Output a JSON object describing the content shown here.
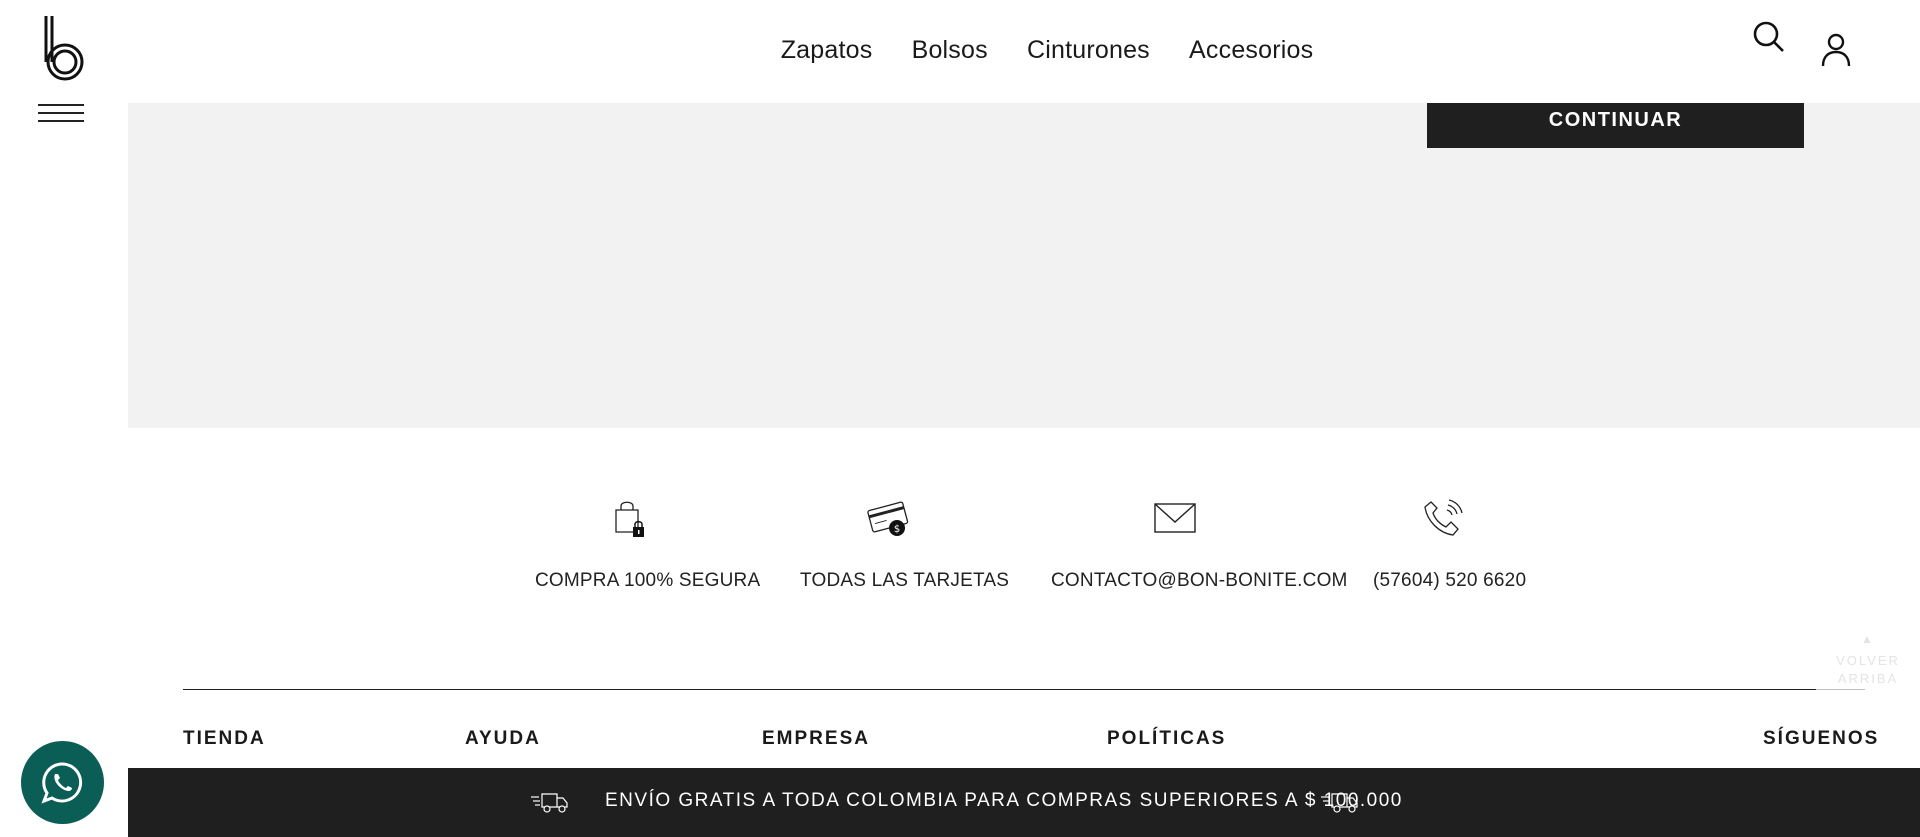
{
  "header": {
    "nav": [
      "Zapatos",
      "Bolsos",
      "Cinturones",
      "Accesorios"
    ],
    "icons": [
      "logo-b",
      "search-icon",
      "user-icon",
      "hamburger-menu-icon"
    ]
  },
  "main": {
    "continue_label": "CONTINUAR"
  },
  "features": [
    {
      "icon": "shopping-bag-lock-icon",
      "label": "COMPRA 100% SEGURA"
    },
    {
      "icon": "credit-card-icon",
      "label": "TODAS LAS TARJETAS"
    },
    {
      "icon": "envelope-icon",
      "label": "CONTACTO@BON-BONITE.COM"
    },
    {
      "icon": "phone-ringing-icon",
      "label": "(57604) 520 6620"
    }
  ],
  "footer": {
    "columns": [
      "TIENDA",
      "AYUDA",
      "EMPRESA",
      "POLÍTICAS",
      "SÍGUENOS"
    ],
    "back_to_top": "VOLVER ARRIBA"
  },
  "bottom_bar": {
    "text": "ENVÍO GRATIS A TODA COLOMBIA PARA COMPRAS SUPERIORES A $ 100.000",
    "icon": "delivery-truck-icon"
  },
  "colors": {
    "bar_dark": "#1f1f1f",
    "panel_gray": "#f2f2f2",
    "whatsapp_green": "#0b5e55"
  }
}
